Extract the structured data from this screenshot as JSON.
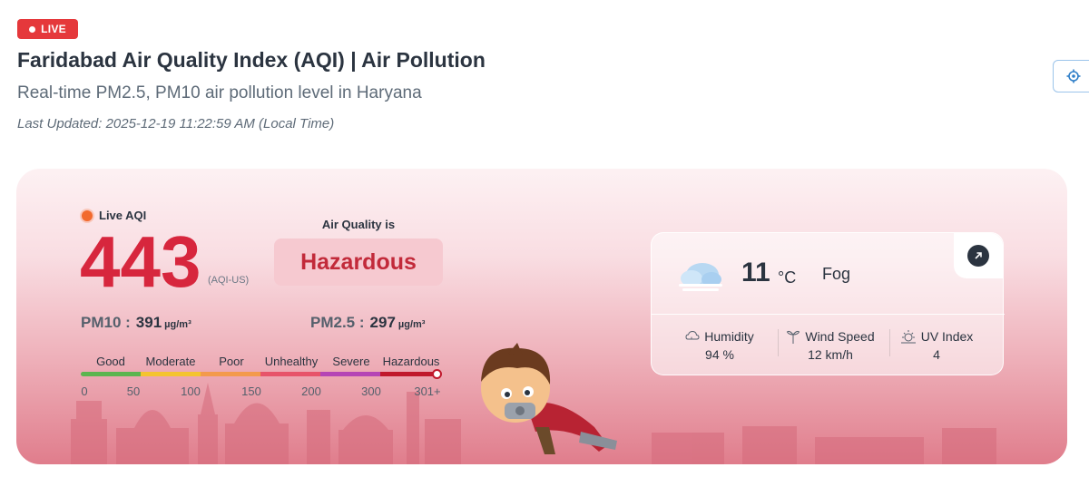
{
  "badge": {
    "label": "LIVE"
  },
  "header": {
    "title": "Faridabad Air Quality Index (AQI) | Air Pollution",
    "subtitle": "Real-time PM2.5, PM10 air pollution level in Haryana",
    "last_updated": "Last Updated: 2025-12-19 11:22:59 AM (Local Time)"
  },
  "aqi": {
    "live_label": "Live AQI",
    "value": "443",
    "unit": "(AQI-US)",
    "air_quality_label": "Air Quality is",
    "status": "Hazardous",
    "pm10_label": "PM10 :",
    "pm10_value": "391",
    "pm10_unit": "µg/m³",
    "pm25_label": "PM2.5 :",
    "pm25_value": "297",
    "pm25_unit": "µg/m³"
  },
  "scale": {
    "categories": [
      "Good",
      "Moderate",
      "Poor",
      "Unhealthy",
      "Severe",
      "Hazardous"
    ],
    "colors": [
      "#5cb54f",
      "#f4c430",
      "#f39a4c",
      "#e7546a",
      "#b545b5",
      "#c0192c"
    ],
    "ticks": [
      "0",
      "50",
      "100",
      "150",
      "200",
      "300",
      "301+"
    ]
  },
  "weather": {
    "temperature": "11",
    "temperature_unit": "°C",
    "condition": "Fog",
    "icon": "fog-cloud-icon",
    "metrics": [
      {
        "label": "Humidity",
        "value": "94 %",
        "icon": "humidity-icon"
      },
      {
        "label": "Wind Speed",
        "value": "12 km/h",
        "icon": "wind-icon"
      },
      {
        "label": "UV Index",
        "value": "4",
        "icon": "sun-icon"
      }
    ]
  },
  "colors": {
    "accent_red": "#e5383b",
    "aqi_red": "#d7263d",
    "status_bg": "#f6c9d0",
    "text_dark": "#2b3440"
  }
}
